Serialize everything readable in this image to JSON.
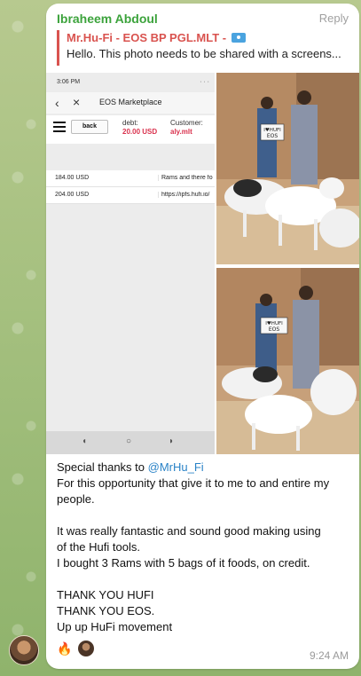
{
  "message": {
    "sender": "Ibraheem Abdoul",
    "reply_label": "Reply",
    "quote": {
      "author": "Mr.Hu-Fi - EOS BP PGL.MLT - ",
      "text": "Hello.  This photo needs to be shared with a screens..."
    },
    "phone_screenshot": {
      "status_time": "3:06 PM",
      "status_icons": "· · ·",
      "title": "EOS Marketplace",
      "back_button": "back",
      "debt_label": "debt:",
      "debt_value": "20.00 USD",
      "customer_label": "Customer:",
      "customer_value": "aly.mlt",
      "rows": [
        {
          "amount": "184.00 USD",
          "note": "Rams and there fo"
        },
        {
          "amount": "204.00 USD",
          "note": "https://ipfs.hufi.io/"
        }
      ]
    },
    "photo_sign": "I ♥ HUFI EOS",
    "body": [
      {
        "prefix": "Special thanks to ",
        "mention": "@MrHu_Fi"
      },
      {
        "text": "For this opportunity that give it to me to and entire my"
      },
      {
        "text": "people."
      },
      {
        "text": ""
      },
      {
        "text": " It was really fantastic and sound good  making using"
      },
      {
        "text": "of the Hufi tools."
      },
      {
        "text": " I bought 3 Rams with  5 bags of it foods, on credit."
      },
      {
        "text": ""
      },
      {
        "text": " THANK YOU HUFI"
      },
      {
        "text": "THANK YOU EOS."
      },
      {
        "text": "Up up HuFi movement"
      }
    ],
    "reaction_emoji": "🔥",
    "time": "9:24 AM"
  }
}
